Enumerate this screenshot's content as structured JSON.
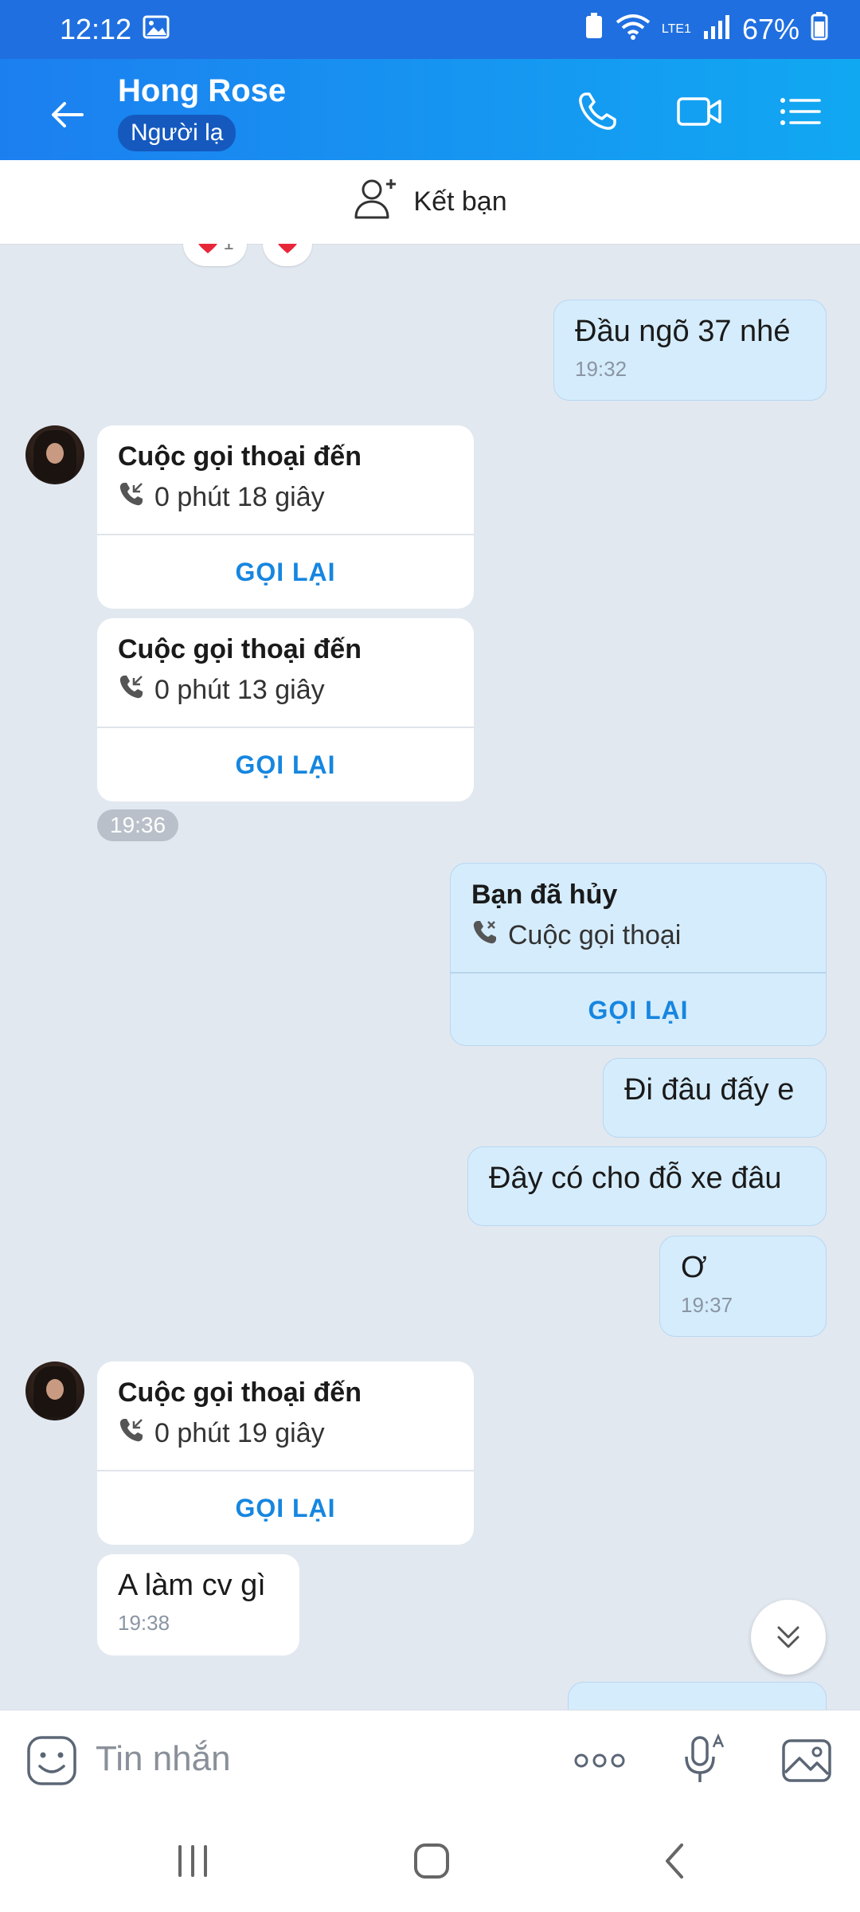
{
  "status_bar": {
    "time": "12:12",
    "battery": "67%",
    "network": "LTE1"
  },
  "header": {
    "contact_name": "Hong Rose",
    "badge": "Người lạ"
  },
  "add_friend": {
    "label": "Kết bạn"
  },
  "reactions": {
    "count": "1"
  },
  "messages": {
    "m1": {
      "text": "Đầu ngõ 37 nhé",
      "time": "19:32"
    },
    "call1": {
      "title": "Cuộc gọi thoại đến",
      "duration": "0 phút 18 giây",
      "action": "GỌI LẠI"
    },
    "call2": {
      "title": "Cuộc gọi thoại đến",
      "duration": "0 phút 13 giây",
      "action": "GỌI LẠI"
    },
    "time_1936": "19:36",
    "call3": {
      "title": "Bạn đã hủy",
      "duration": "Cuộc gọi thoại",
      "action": "GỌI LẠI"
    },
    "m2": {
      "text": "Đi đâu đấy e"
    },
    "m3": {
      "text": "Đây có cho đỗ xe đâu"
    },
    "m4": {
      "text": "Ơ",
      "time": "19:37"
    },
    "call4": {
      "title": "Cuộc gọi thoại đến",
      "duration": "0 phút 19 giây",
      "action": "GỌI LẠI"
    },
    "m5": {
      "text": "A làm cv gì",
      "time": "19:38"
    }
  },
  "input": {
    "placeholder": "Tin nhắn"
  },
  "colors": {
    "header_start": "#1c7ff0",
    "header_end": "#11a8f2",
    "accent": "#1686e0",
    "outgoing_bubble": "#d5ecfc",
    "chat_bg": "#e2e8f0"
  }
}
